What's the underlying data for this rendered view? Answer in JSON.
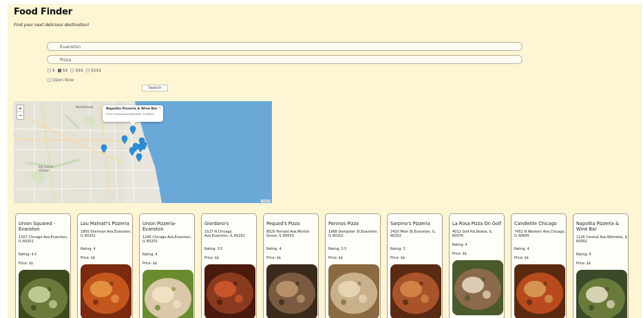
{
  "app": {
    "title": "Food Finder",
    "subtitle": "Find your next delicious destination!"
  },
  "search": {
    "location_value": "Evanston",
    "term_value": "Pizza",
    "price_options": [
      "$",
      "$$",
      "$$$",
      "$$$$"
    ],
    "price_checked": [
      false,
      true,
      false,
      false
    ],
    "open_now_label": "Open Now",
    "open_now_checked": false,
    "search_button": "Search"
  },
  "map": {
    "zoom_in": "+",
    "zoom_out": "−",
    "popup_name": "Napolita Pizzeria & Wine Bar",
    "popup_address": "1126 Central Ave,Wilmette, IL 60091",
    "popup_close": "×",
    "attribution": "Leaflet",
    "place_labels": [
      "Northbrook",
      "Elk Grove Village"
    ],
    "colors": {
      "water": "#6aa8d8",
      "land": "#e8e6dd",
      "marker": "#2a8fd8"
    }
  },
  "results": [
    {
      "name": "Union Squared - Evanston",
      "address": "1307 Chicago Ave,Evanston, IL 60201",
      "rating_label": "Rating: 4.5",
      "price_label": "Price: $$"
    },
    {
      "name": "Lou Malnati's Pizzeria",
      "address": "1850 Sherman Ave,Evanston, IL 60201",
      "rating_label": "Rating: 4",
      "price_label": "Price: $$"
    },
    {
      "name": "Union Pizzeria- Evanston",
      "address": "1245 Chicago Ave,Evanston, IL 60202",
      "rating_label": "Rating: 4",
      "price_label": "Price: $$"
    },
    {
      "name": "Giordano's",
      "address": "1527 N Chicago Ave,Evanston, IL 60201",
      "rating_label": "Rating: 3.5",
      "price_label": "Price: $$"
    },
    {
      "name": "Pequod's Pizza",
      "address": "8520 Fernald Ave,Morton Grove, IL 60053",
      "rating_label": "Rating: 4",
      "price_label": "Price: $$"
    },
    {
      "name": "Paninos Pizza",
      "address": "1968 Dempster St,Evanston, IL 60202",
      "rating_label": "Rating: 3.5",
      "price_label": "Price: $$"
    },
    {
      "name": "Sarpino's Pizzeria",
      "address": "2420 Main St,Evanston, IL 60202",
      "rating_label": "Rating: 3",
      "price_label": "Price: $$"
    },
    {
      "name": "La Rosa Pizza On Golf",
      "address": "4012 Golf Rd,Skokie, IL 60076",
      "rating_label": "Rating: 4",
      "price_label": "Price: $$"
    },
    {
      "name": "Candlelite Chicago",
      "address": "7452 N Western Ave,Chicago, IL 60645",
      "rating_label": "Rating: 4",
      "price_label": "Price: $$"
    },
    {
      "name": "Napolita Pizzeria & Wine Bar",
      "address": "1126 Central Ave,Wilmette, IL 60091",
      "rating_label": "Rating: 4",
      "price_label": "Price: $$"
    }
  ]
}
